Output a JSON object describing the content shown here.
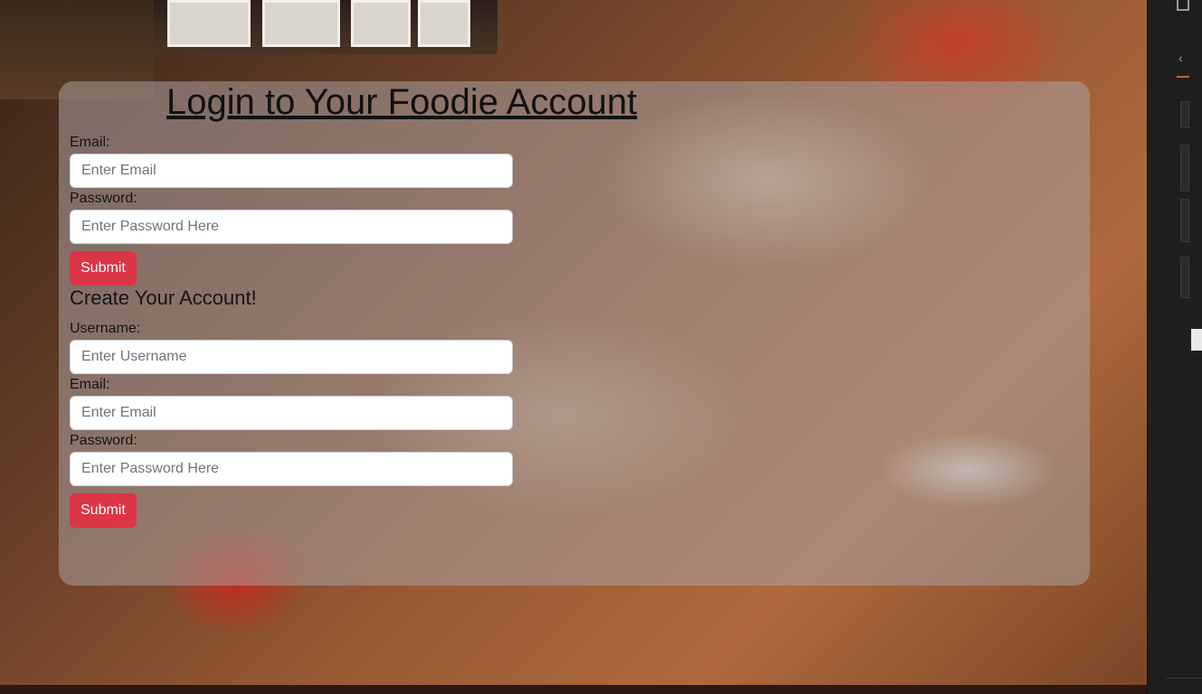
{
  "login": {
    "title": "Login to Your Foodie Account",
    "email_label": "Email:",
    "email_placeholder": "Enter Email",
    "password_label": "Password:",
    "password_placeholder": "Enter Password Here",
    "submit_label": "Submit"
  },
  "register": {
    "title": "Create Your Account!",
    "username_label": "Username:",
    "username_placeholder": "Enter Username",
    "email_label": "Email:",
    "email_placeholder": "Enter Email",
    "password_label": "Password:",
    "password_placeholder": "Enter Password Here",
    "submit_label": "Submit"
  },
  "colors": {
    "submit_button": "#dc3545",
    "card_overlay": "rgba(170,160,160,0.55)"
  }
}
